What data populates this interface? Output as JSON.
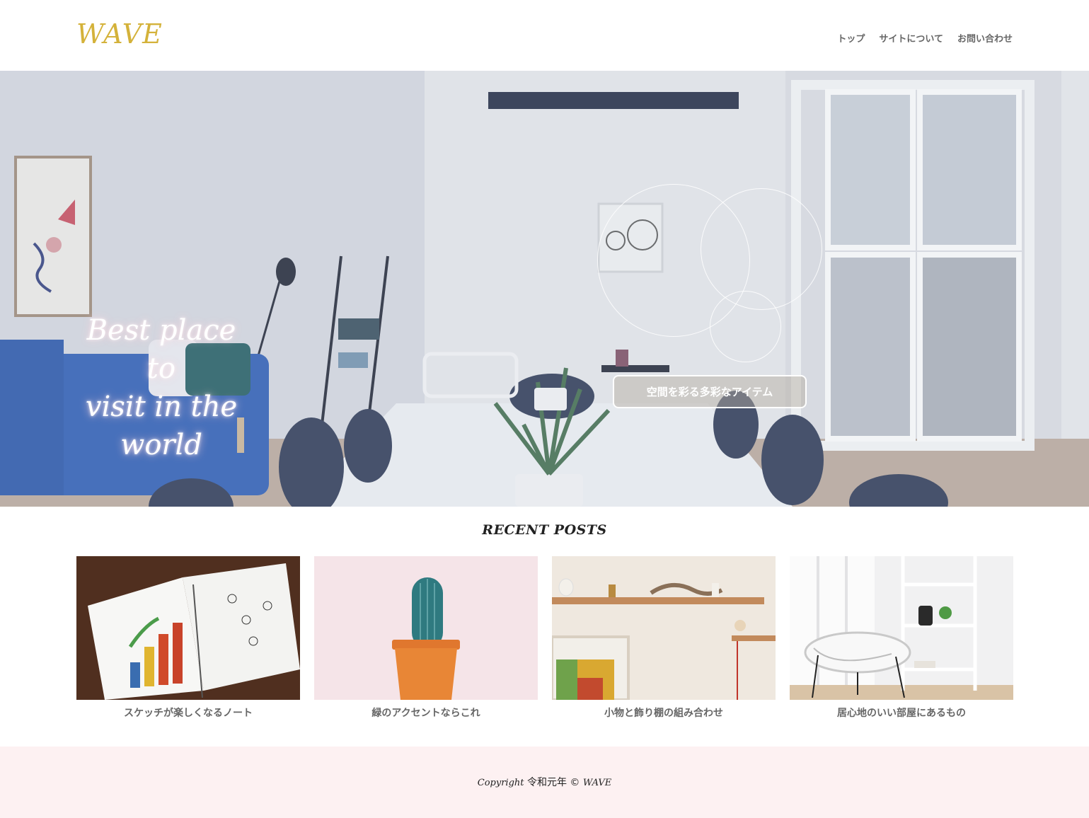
{
  "brand": {
    "logo": "WAVE",
    "logo_color": "#d4b23a"
  },
  "nav": {
    "items": [
      "トップ",
      "サイトについて",
      "お問い合わせ"
    ]
  },
  "hero": {
    "title_lines": [
      "Best place to",
      "visit in the",
      "world"
    ],
    "button_label": "空間を彩る多彩なアイテム"
  },
  "recent_posts": {
    "heading": "RECENT POSTS",
    "items": [
      {
        "title": "スケッチが楽しくなるノート"
      },
      {
        "title": "緑のアクセントならこれ"
      },
      {
        "title": "小物と飾り棚の組み合わせ"
      },
      {
        "title": "居心地のいい部屋にあるもの"
      }
    ]
  },
  "footer": {
    "copyright_word": "Copyright",
    "era": "令和元年",
    "symbol": "©",
    "brand": "WAVE",
    "background": "#fdf1f2"
  },
  "icons": [
    "circle-decoration"
  ]
}
